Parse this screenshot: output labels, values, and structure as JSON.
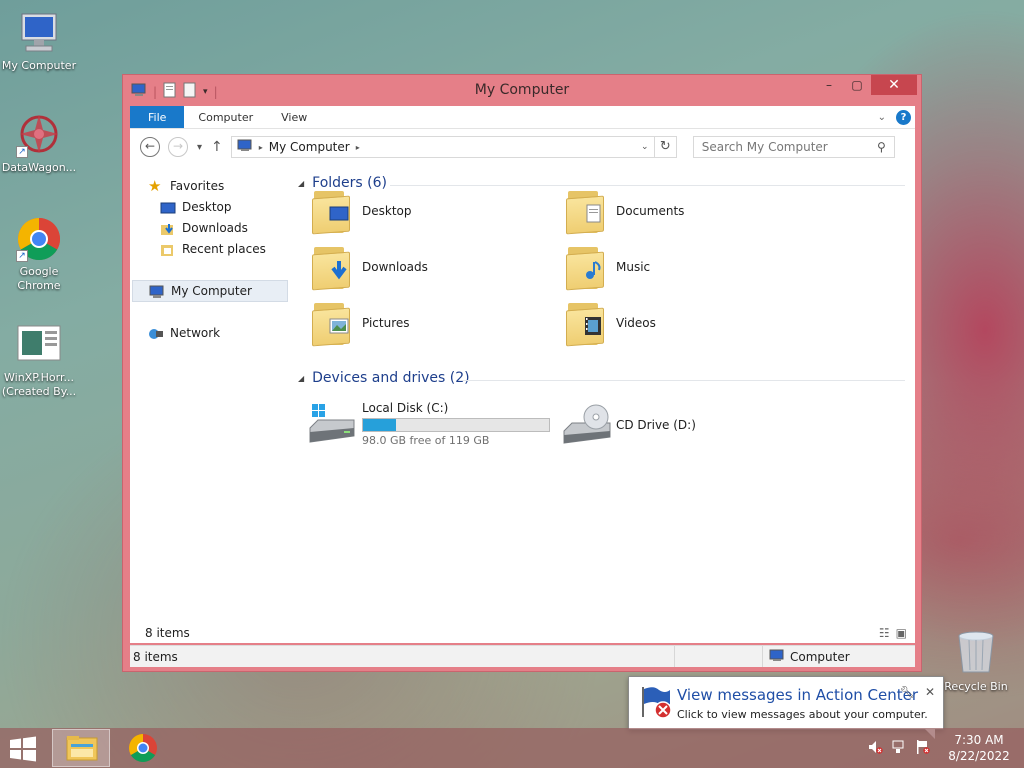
{
  "desktop": {
    "icons": [
      {
        "label": "My Computer"
      },
      {
        "label": "DataWagon..."
      },
      {
        "label": "Google Chrome"
      },
      {
        "label": "WinXP.Horr... (Created By..."
      }
    ],
    "recycle_bin": "Recycle Bin"
  },
  "window": {
    "title": "My Computer",
    "ribbon_tabs": [
      "File",
      "Computer",
      "View"
    ],
    "address": {
      "crumb": "My Computer"
    },
    "search": {
      "placeholder": "Search My Computer"
    },
    "nav": {
      "favorites": "Favorites",
      "desktop": "Desktop",
      "downloads": "Downloads",
      "recent": "Recent places",
      "computer": "My Computer",
      "network": "Network"
    },
    "folders_header": "Folders (6)",
    "folders": [
      {
        "label": "Desktop",
        "icon": "desktop-badge"
      },
      {
        "label": "Documents",
        "icon": "documents-badge"
      },
      {
        "label": "Downloads",
        "icon": "download-arrow-badge"
      },
      {
        "label": "Music",
        "icon": "music-note-badge"
      },
      {
        "label": "Pictures",
        "icon": "picture-badge"
      },
      {
        "label": "Videos",
        "icon": "film-badge"
      }
    ],
    "devices_header": "Devices and drives (2)",
    "drives": [
      {
        "label": "Local Disk (C:)",
        "free_text": "98.0 GB free of 119 GB",
        "used_fraction": 0.18
      },
      {
        "label": "CD Drive (D:)"
      }
    ],
    "items_count_inner": "8 items",
    "status_left": "8 items",
    "status_right": "Computer"
  },
  "toast": {
    "title": "View messages in Action Center",
    "body": "Click to view messages about your computer."
  },
  "taskbar": {
    "time": "7:30 AM",
    "date": "8/22/2022"
  },
  "colors": {
    "window_frame": "#e57f88",
    "close_button": "#c7464f",
    "file_tab": "#1979ca",
    "header_text": "#1e3f8c",
    "progress_fill": "#26a0da"
  }
}
